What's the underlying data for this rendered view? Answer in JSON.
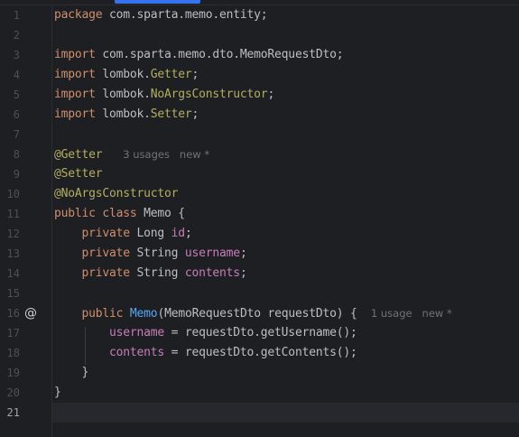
{
  "editor": {
    "active_line": 21,
    "lines": [
      {
        "num": "1"
      },
      {
        "num": "2"
      },
      {
        "num": "3"
      },
      {
        "num": "4"
      },
      {
        "num": "5"
      },
      {
        "num": "6"
      },
      {
        "num": "7"
      },
      {
        "num": "8"
      },
      {
        "num": "9"
      },
      {
        "num": "10"
      },
      {
        "num": "11"
      },
      {
        "num": "12"
      },
      {
        "num": "13"
      },
      {
        "num": "14"
      },
      {
        "num": "15"
      },
      {
        "num": "16"
      },
      {
        "num": "17"
      },
      {
        "num": "18"
      },
      {
        "num": "19"
      },
      {
        "num": "20"
      },
      {
        "num": "21"
      }
    ],
    "tokens": {
      "l1_kw": "package",
      "l1_rest": " com.sparta.memo.entity;",
      "l3_kw": "import",
      "l3_rest": " com.sparta.memo.dto.MemoRequestDto;",
      "l4_kw": "import",
      "l4_pre": " lombok.",
      "l4_ann": "Getter",
      "l4_end": ";",
      "l5_kw": "import",
      "l5_pre": " lombok.",
      "l5_ann": "NoArgsConstructor",
      "l5_end": ";",
      "l6_kw": "import",
      "l6_pre": " lombok.",
      "l6_ann": "Setter",
      "l6_end": ";",
      "l8_ann": "@Getter",
      "l8_hint": "3 usages   new *",
      "l9_ann": "@Setter",
      "l10_ann": "@NoArgsConstructor",
      "l11_kw": "public class",
      "l11_rest": " Memo {",
      "l12_kw": "private",
      "l12_type": " Long ",
      "l12_fld": "id",
      "l12_end": ";",
      "l13_kw": "private",
      "l13_type": " String ",
      "l13_fld": "username",
      "l13_end": ";",
      "l14_kw": "private",
      "l14_type": " String ",
      "l14_fld": "contents",
      "l14_end": ";",
      "l16_kw": "public",
      "l16_mth": "Memo",
      "l16_rest": "(MemoRequestDto requestDto) {",
      "l16_hint": "1 usage   new *",
      "l17_fld": "username",
      "l17_rest": " = requestDto.getUsername();",
      "l18_fld": "contents",
      "l18_rest": " = requestDto.getContents();",
      "l19_rest": "}",
      "l20_rest": "}"
    },
    "gutter_icon": "implementation-at-icon",
    "gutter_icon_glyph": "@"
  },
  "colors": {
    "background": "#1e1f22",
    "keyword": "#cf8e6d",
    "annotation": "#b3ae60",
    "field": "#c77dbb",
    "method": "#56a8f5",
    "text": "#bcbec4",
    "hint": "#6f737a",
    "line_number": "#4b5059",
    "tab_accent": "#3574f0"
  }
}
